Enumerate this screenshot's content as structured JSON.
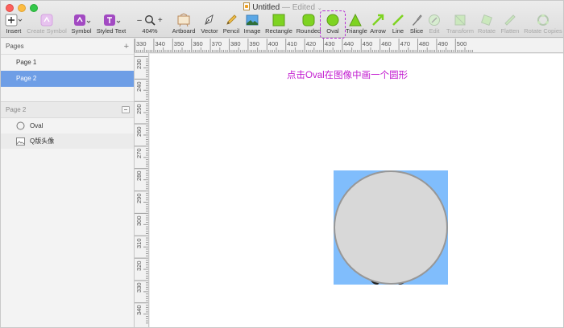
{
  "window": {
    "title": "Untitled",
    "edited_suffix": "— Edited",
    "caret": "⌄"
  },
  "toolbar": {
    "insert": "Insert",
    "create_symbol": "Create Symbol",
    "symbol": "Symbol",
    "styled_text": "Styled Text",
    "zoom": "404%",
    "zoom_minus": "–",
    "zoom_plus": "+",
    "artboard": "Artboard",
    "vector": "Vector",
    "pencil": "Pencil",
    "image": "Image",
    "rectangle": "Rectangle",
    "rounded": "Rounded",
    "oval": "Oval",
    "triangle": "Triangle",
    "arrow": "Arrow",
    "line": "Line",
    "slice": "Slice",
    "edit": "Edit",
    "transform": "Transform",
    "rotate": "Rotate",
    "flatten": "Flatten",
    "rotate_copies": "Rotate Copies"
  },
  "sidebar": {
    "pages_header": "Pages",
    "add_page": "+",
    "pages": [
      "Page 1",
      "Page 2"
    ],
    "selected_page": "Page 2",
    "layers_header": "Page 2",
    "layers": [
      {
        "label": "Oval",
        "icon": "oval-layer-icon"
      },
      {
        "label": "Q版头像",
        "icon": "image-layer-icon"
      }
    ]
  },
  "rulers": {
    "top": [
      "330",
      "340",
      "350",
      "360",
      "370",
      "380",
      "390",
      "400",
      "410",
      "420",
      "430",
      "440",
      "450",
      "460",
      "470",
      "480",
      "490",
      "500"
    ],
    "left": [
      "230",
      "240",
      "250",
      "260",
      "270",
      "280",
      "290",
      "300",
      "310",
      "320",
      "330",
      "340"
    ]
  },
  "canvas": {
    "annotation": "点击Oval在图像中画一个圆形"
  },
  "colors": {
    "accent_selected": "#6e9ee6",
    "annotation": "#c21bd0",
    "highlight": "#b52fd4",
    "artboard_bg": "#80bdfc",
    "oval_fill": "#d8d8d8",
    "oval_stroke": "#979797",
    "shape_green": "#7ed321"
  }
}
